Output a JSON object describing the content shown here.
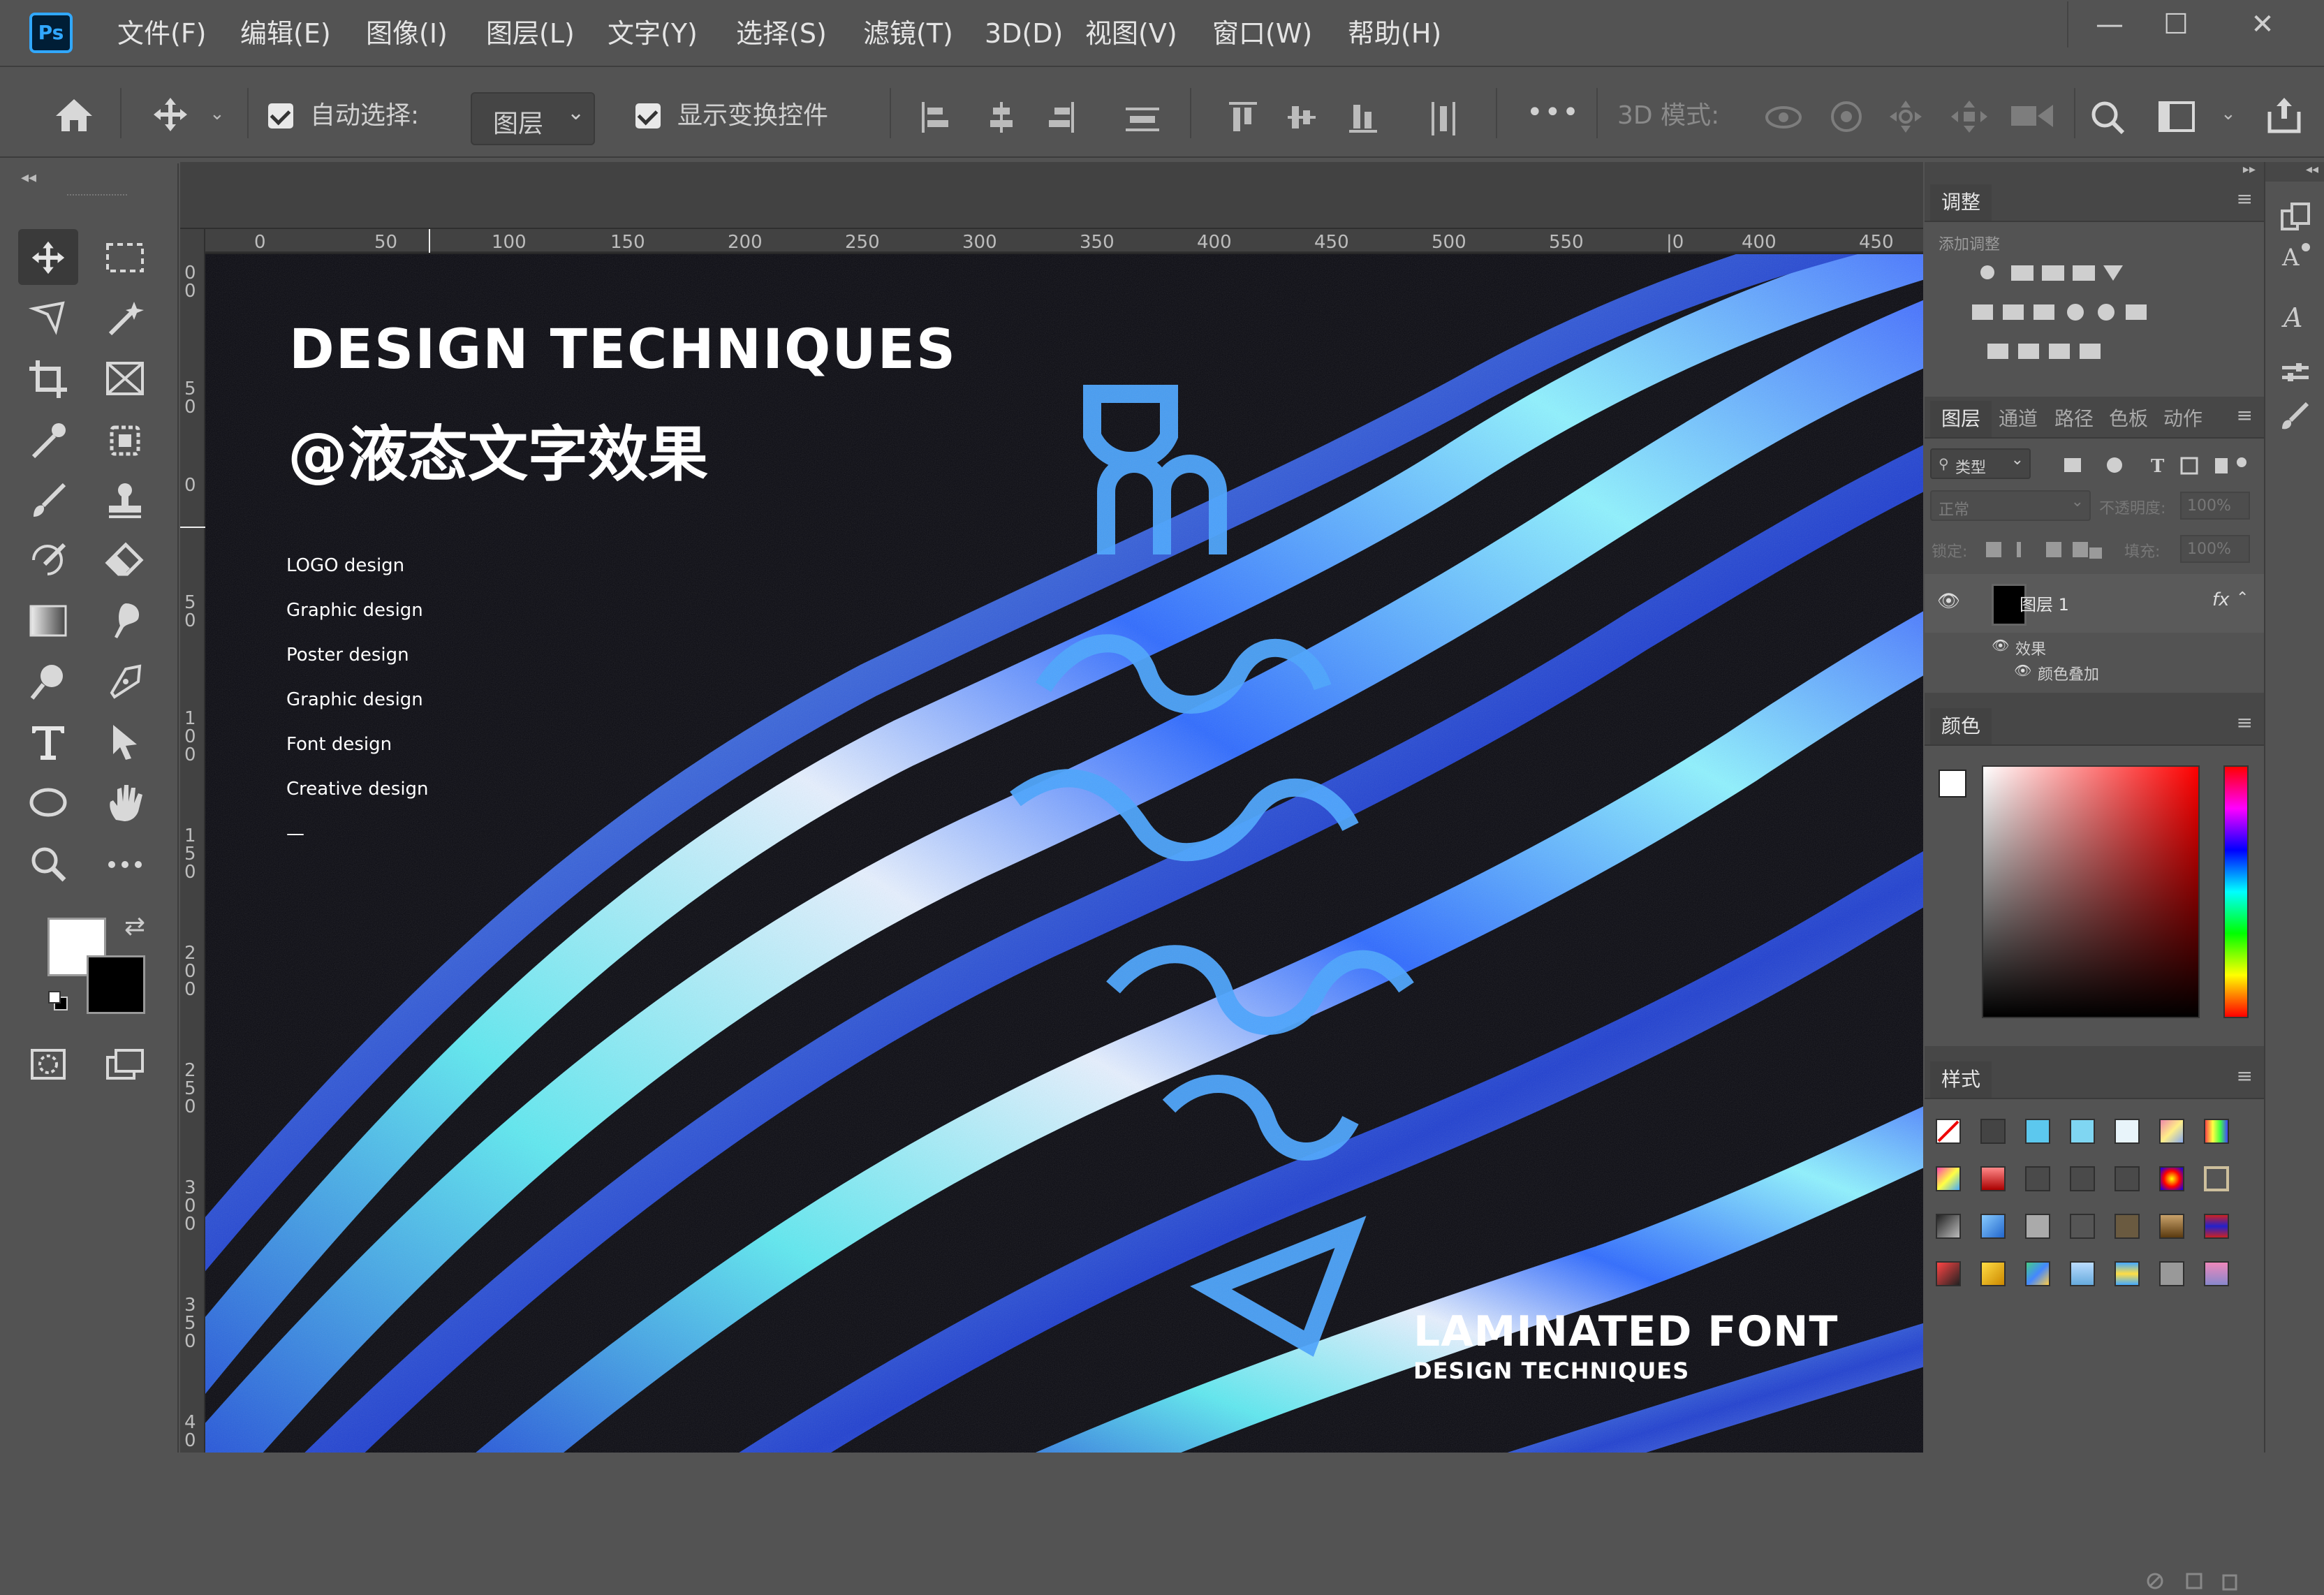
{
  "app": {
    "logo": "Ps",
    "menu": [
      "文件(F)",
      "编辑(E)",
      "图像(I)",
      "图层(L)",
      "文字(Y)",
      "选择(S)",
      "滤镜(T)",
      "3D(D)",
      "视图(V)",
      "窗口(W)",
      "帮助(H)"
    ],
    "window_controls": {
      "minimize": "—",
      "maximize": "☐",
      "close": "✕"
    }
  },
  "options": {
    "auto_select_label": "自动选择:",
    "auto_select_target": "图层",
    "show_transform_label": "显示变换控件",
    "mode_3d_label": "3D 模式:",
    "more": "•••"
  },
  "ruler": {
    "h_ticks": [
      "0",
      "50",
      "100",
      "150",
      "200",
      "250",
      "300",
      "350",
      "400",
      "450",
      "500",
      "550",
      "|0",
      "400",
      "450"
    ],
    "v_ticks": [
      "0\n0",
      "5\n0",
      "0",
      "5\n0",
      "1\n0\n0",
      "1\n5\n0",
      "2\n0\n0",
      "2\n5\n0",
      "3\n0\n0",
      "3\n5\n0",
      "4\n0"
    ]
  },
  "artwork": {
    "headline": "DESIGN TECHNIQUES",
    "subheadline": "@液态文字效果",
    "services": [
      "LOGO design",
      "Graphic design",
      "Poster design",
      "Graphic design",
      "Font design",
      "Creative design"
    ],
    "dash": "—",
    "footer_title": "LAMINATED FONT",
    "footer_sub": "DESIGN TECHNIQUES"
  },
  "adjustments_panel": {
    "tab": "调整",
    "add_label": "添加调整"
  },
  "layers_panel": {
    "tabs": [
      "图层",
      "通道",
      "路径",
      "色板",
      "动作"
    ],
    "filter_kind": "类型",
    "blend_mode": "正常",
    "opacity_label": "不透明度:",
    "opacity_value": "100%",
    "lock_label": "锁定:",
    "fill_label": "填充:",
    "fill_value": "100%",
    "layer_name": "图层 1",
    "fx": "fx",
    "effects_label": "效果",
    "effect_item": "颜色叠加"
  },
  "color_panel": {
    "tab": "颜色"
  },
  "styles_panel": {
    "tab": "样式"
  },
  "colors": {
    "foreground": "#ffffff",
    "background": "#000000",
    "accent_cyan": "#5fe8f0",
    "accent_blue": "#2f6bff"
  }
}
